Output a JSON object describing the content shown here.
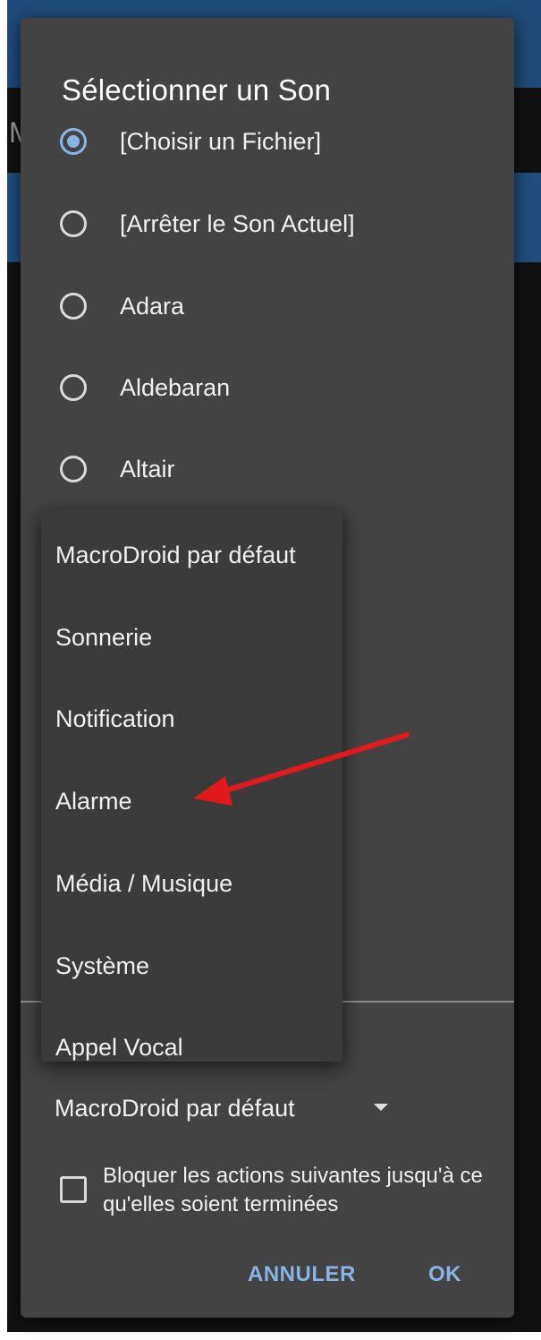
{
  "dialog": {
    "title": "Sélectionner un Son",
    "sound_options": [
      {
        "label": "[Choisir un Fichier]",
        "selected": true
      },
      {
        "label": "[Arrêter le Son Actuel]",
        "selected": false
      },
      {
        "label": "Adara",
        "selected": false
      },
      {
        "label": "Aldebaran",
        "selected": false
      },
      {
        "label": "Altair",
        "selected": false
      }
    ],
    "stream_selector": {
      "value": "MacroDroid par défaut"
    },
    "block_actions": {
      "label": "Bloquer les actions suivantes jusqu'à ce qu'elles soient terminées",
      "checked": false
    },
    "buttons": {
      "cancel": "ANNULER",
      "ok": "OK"
    }
  },
  "dropdown_menu": {
    "items": [
      "MacroDroid par défaut",
      "Sonnerie",
      "Notification",
      "Alarme",
      "Média / Musique",
      "Système",
      "Appel Vocal"
    ],
    "highlighted_item": "Alarme"
  },
  "colors": {
    "dialog_bg": "#434343",
    "menu_bg": "#3b3b3b",
    "accent": "#8ab4e6",
    "annotation_arrow": "#e0191c"
  }
}
